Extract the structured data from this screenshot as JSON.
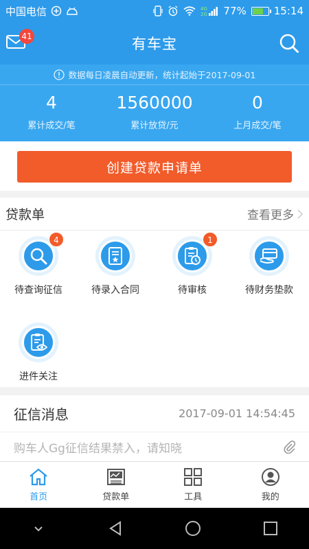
{
  "status_bar": {
    "carrier": "中国电信",
    "network": "4G 2G",
    "battery_percent": "77%",
    "battery_level": 0.77,
    "time": "15:14"
  },
  "header": {
    "title": "有车宝",
    "mail_badge": "41"
  },
  "summary": {
    "notice": "数据每日凌晨自动更新，统计起始于2017-09-01",
    "stats": [
      {
        "value": "4",
        "label": "累计成交/笔"
      },
      {
        "value": "1560000",
        "label": "累计放贷/元"
      },
      {
        "value": "0",
        "label": "上月成交/笔"
      }
    ]
  },
  "create_button": "创建贷款申请单",
  "loan_section": {
    "title": "贷款单",
    "more": "查看更多",
    "items": [
      {
        "label": "待查询征信",
        "badge": "4",
        "icon": "magnifier-icon"
      },
      {
        "label": "待录入合同",
        "badge": "",
        "icon": "contract-icon"
      },
      {
        "label": "待审核",
        "badge": "1",
        "icon": "clipboard-clock-icon"
      },
      {
        "label": "待财务垫款",
        "badge": "",
        "icon": "card-hand-icon"
      },
      {
        "label": "进件关注",
        "badge": "",
        "icon": "clipboard-eye-icon"
      }
    ]
  },
  "credit_section": {
    "title": "征信消息",
    "time": "2017-09-01 14:54:45",
    "message": "购车人Gg征信结果禁入，请知晓"
  },
  "tabs": [
    {
      "label": "首页",
      "icon": "home-icon",
      "active": true
    },
    {
      "label": "贷款单",
      "icon": "chart-icon",
      "active": false
    },
    {
      "label": "工具",
      "icon": "grid-icon",
      "active": false
    },
    {
      "label": "我的",
      "icon": "user-icon",
      "active": false
    }
  ],
  "colors": {
    "primary": "#2d9bea",
    "accent": "#f25b2a"
  }
}
